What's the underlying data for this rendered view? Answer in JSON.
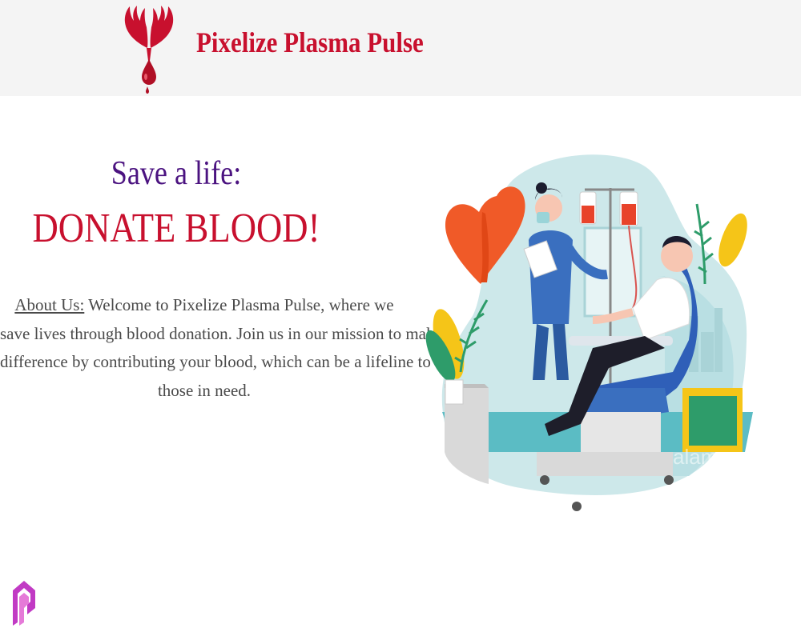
{
  "header": {
    "brand_name": "Pixelize Plasma Pulse",
    "logo_icon": "hands-blood-drop-logo",
    "brand_color": "#c8102e"
  },
  "hero": {
    "tagline_top": "Save a life:",
    "tagline_main": "DONATE BLOOD!",
    "tagline_top_color": "#4b1380",
    "tagline_main_color": "#c8102e"
  },
  "about": {
    "label": "About Us:",
    "line1": " Welcome to Pixelize Plasma Pulse, where we",
    "line2": "save lives through blood donation. Join us in our mission to make a",
    "line3": "difference by contributing your blood, which can be a lifeline to",
    "line4": "those in need."
  },
  "illustration": {
    "icon": "blood-donation-illustration",
    "watermark": "alamy"
  },
  "corner_mark": {
    "icon": "pixelize-p-logo-icon"
  }
}
